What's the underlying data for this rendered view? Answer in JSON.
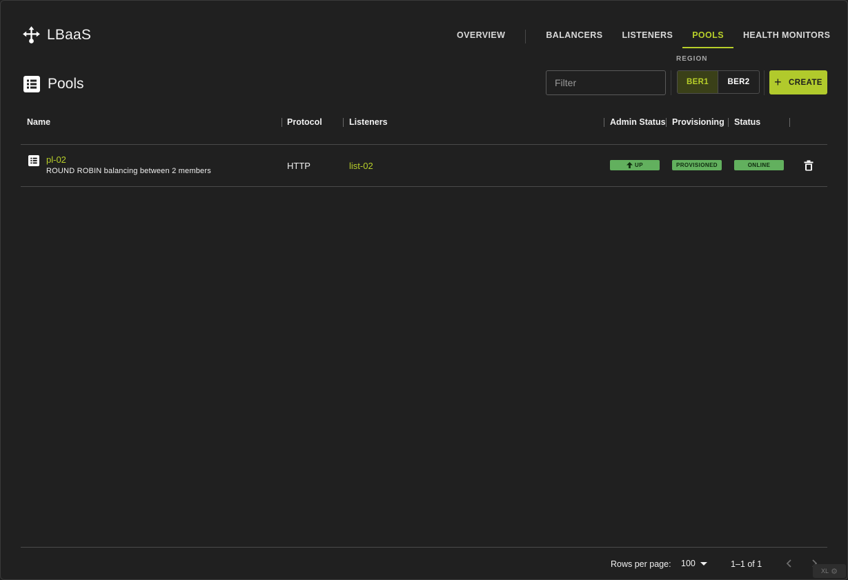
{
  "app": {
    "name": "LBaaS"
  },
  "nav": {
    "items": [
      {
        "label": "OVERVIEW"
      },
      {
        "label": "BALANCERS"
      },
      {
        "label": "LISTENERS"
      },
      {
        "label": "POOLS",
        "active": true
      },
      {
        "label": "HEALTH MONITORS"
      }
    ]
  },
  "page": {
    "title": "Pools"
  },
  "toolbar": {
    "filter_placeholder": "Filter",
    "region_label": "REGION",
    "regions": [
      {
        "label": "BER1",
        "active": true
      },
      {
        "label": "BER2",
        "active": false
      }
    ],
    "create_label": "CREATE"
  },
  "table": {
    "columns": [
      "Name",
      "Protocol",
      "Listeners",
      "Admin Status",
      "Provisioning",
      "Status"
    ],
    "rows": [
      {
        "name": "pl-02",
        "description": "ROUND ROBIN balancing between 2 members",
        "protocol": "HTTP",
        "listener": "list-02",
        "admin_status": "UP",
        "provisioning": "PROVISIONED",
        "status": "ONLINE"
      }
    ]
  },
  "pagination": {
    "rows_per_page_label": "Rows per page:",
    "rows_per_page": "100",
    "range": "1–1 of 1"
  },
  "corner_badge": {
    "label": "XL"
  },
  "colors": {
    "background": "#202020",
    "accent": "#b8cf2a",
    "create_button": "#b1ca2c",
    "status_badge": "#62b05e"
  },
  "icons": {
    "brand": "arrows-split-icon",
    "page": "list-icon",
    "row": "list-icon",
    "delete": "trash-icon",
    "admin_up": "arrow-up-icon"
  }
}
